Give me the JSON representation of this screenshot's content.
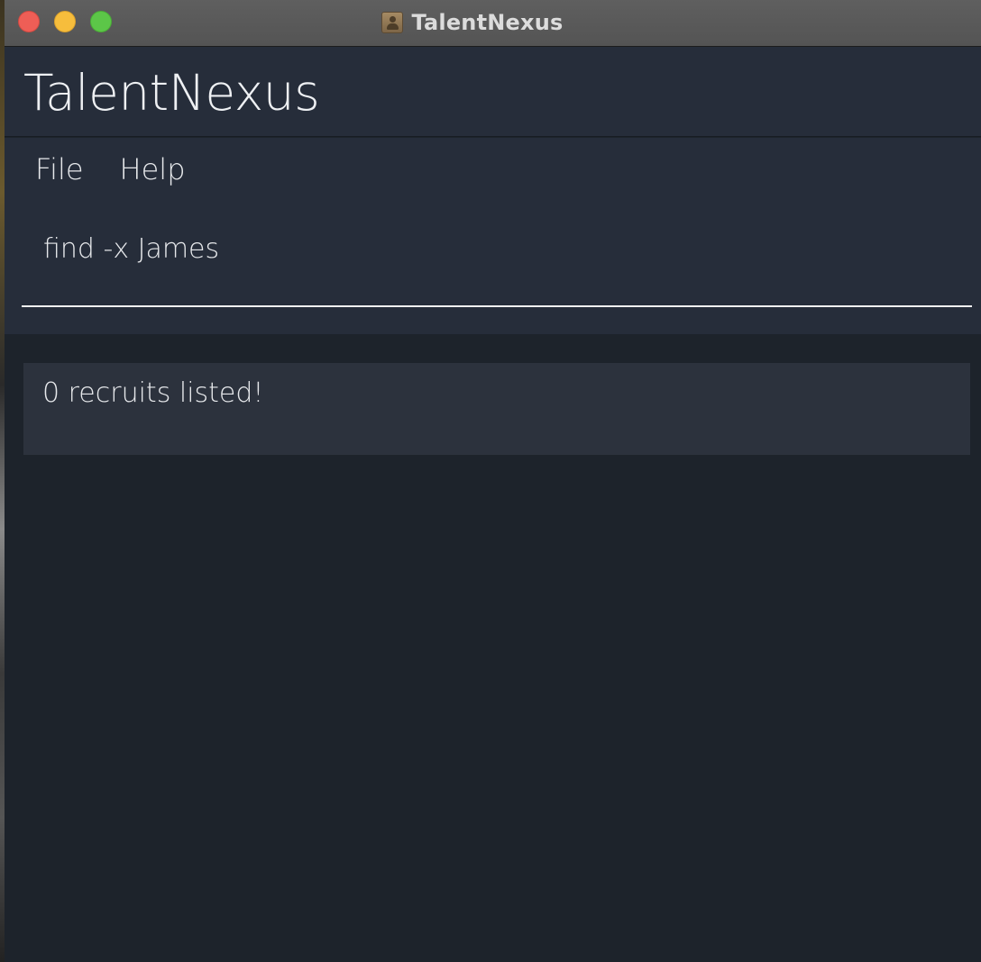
{
  "window": {
    "title": "TalentNexus",
    "app_icon": "contacts-book-icon"
  },
  "header": {
    "app_name": "TalentNexus"
  },
  "menu": {
    "items": [
      {
        "label": "File"
      },
      {
        "label": "Help"
      }
    ]
  },
  "command": {
    "value": "find -x James"
  },
  "result": {
    "message": "0 recruits listed!"
  },
  "colors": {
    "background": "#1d232b",
    "header": "#262d3a",
    "result_panel": "#2c323d",
    "text": "#e6e8eb",
    "close": "#ee5e56",
    "minimize": "#f6bd3c",
    "zoom": "#5cc648"
  }
}
